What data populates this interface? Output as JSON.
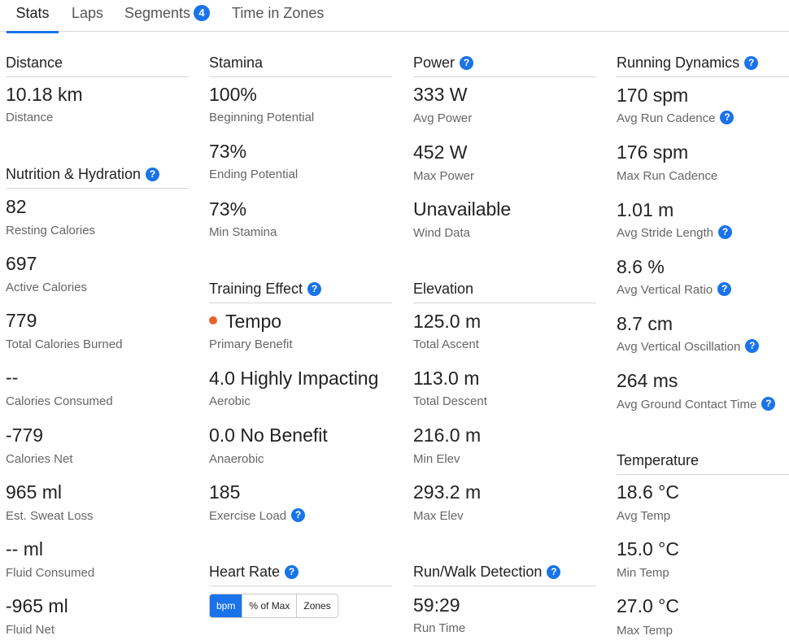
{
  "tabs": [
    {
      "label": "Stats"
    },
    {
      "label": "Laps"
    },
    {
      "label": "Segments",
      "badge": "4"
    },
    {
      "label": "Time in Zones"
    }
  ],
  "help_glyph": "?",
  "distance": {
    "title": "Distance",
    "value": "10.18 km",
    "label": "Distance"
  },
  "nutrition": {
    "title": "Nutrition & Hydration",
    "items": [
      {
        "value": "82",
        "label": "Resting Calories"
      },
      {
        "value": "697",
        "label": "Active Calories"
      },
      {
        "value": "779",
        "label": "Total Calories Burned"
      },
      {
        "value": "--",
        "label": "Calories Consumed"
      },
      {
        "value": "-779",
        "label": "Calories Net"
      },
      {
        "value": "965 ml",
        "label": "Est. Sweat Loss"
      },
      {
        "value": "-- ml",
        "label": "Fluid Consumed"
      },
      {
        "value": "-965 ml",
        "label": "Fluid Net"
      }
    ]
  },
  "stamina": {
    "title": "Stamina",
    "items": [
      {
        "value": "100%",
        "label": "Beginning Potential"
      },
      {
        "value": "73%",
        "label": "Ending Potential"
      },
      {
        "value": "73%",
        "label": "Min Stamina"
      }
    ]
  },
  "training_effect": {
    "title": "Training Effect",
    "items": [
      {
        "value": "Tempo",
        "label": "Primary Benefit"
      },
      {
        "value": "4.0 Highly Impacting",
        "label": "Aerobic"
      },
      {
        "value": "0.0 No Benefit",
        "label": "Anaerobic"
      },
      {
        "value": "185",
        "label": "Exercise Load"
      }
    ],
    "benefit_dot_color": "#e8622a"
  },
  "heart_rate": {
    "title": "Heart Rate",
    "buttons": [
      "bpm",
      "% of Max",
      "Zones"
    ],
    "active": "bpm"
  },
  "power": {
    "title": "Power",
    "items": [
      {
        "value": "333 W",
        "label": "Avg Power"
      },
      {
        "value": "452 W",
        "label": "Max Power"
      },
      {
        "value": "Unavailable",
        "label": "Wind Data"
      }
    ]
  },
  "elevation": {
    "title": "Elevation",
    "items": [
      {
        "value": "125.0 m",
        "label": "Total Ascent"
      },
      {
        "value": "113.0 m",
        "label": "Total Descent"
      },
      {
        "value": "216.0 m",
        "label": "Min Elev"
      },
      {
        "value": "293.2 m",
        "label": "Max Elev"
      }
    ]
  },
  "run_walk": {
    "title": "Run/Walk Detection",
    "value": "59:29",
    "label": "Run Time"
  },
  "running_dynamics": {
    "title": "Running Dynamics",
    "items": [
      {
        "value": "170 spm",
        "label": "Avg Run Cadence"
      },
      {
        "value": "176 spm",
        "label": "Max Run Cadence"
      },
      {
        "value": "1.01 m",
        "label": "Avg Stride Length"
      },
      {
        "value": "8.6 %",
        "label": "Avg Vertical Ratio"
      },
      {
        "value": "8.7 cm",
        "label": "Avg Vertical Oscillation"
      },
      {
        "value": "264 ms",
        "label": "Avg Ground Contact Time"
      }
    ]
  },
  "temperature": {
    "title": "Temperature",
    "items": [
      {
        "value": "18.6 °C",
        "label": "Avg Temp"
      },
      {
        "value": "15.0 °C",
        "label": "Min Temp"
      },
      {
        "value": "27.0 °C",
        "label": "Max Temp"
      }
    ]
  },
  "colors": {
    "accent": "#1a73e8",
    "dot": "#e8622a"
  }
}
